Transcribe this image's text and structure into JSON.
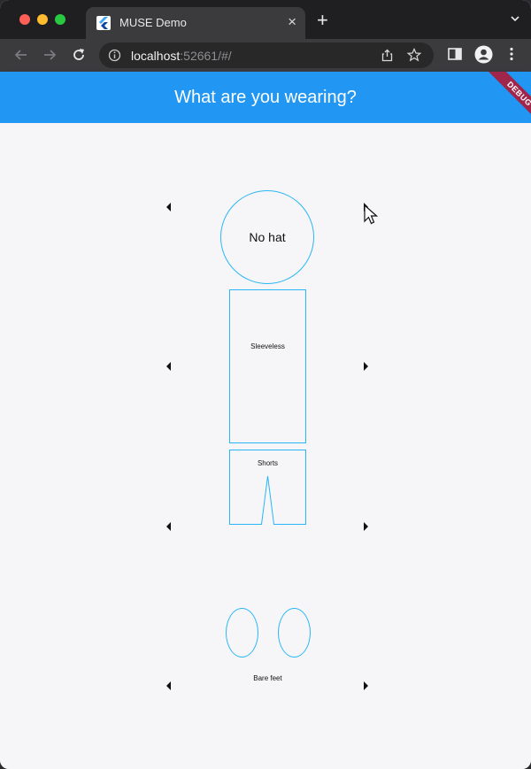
{
  "browser": {
    "tab_title": "MUSE Demo",
    "tab_close": "×",
    "new_tab": "+",
    "url_host": "localhost",
    "url_rest": ":52661/#/"
  },
  "app": {
    "title": "What are you wearing?",
    "debug_banner": "DEBUG",
    "accent_color": "#2196f3",
    "outline_color": "#29b6f6"
  },
  "outfit": {
    "hat": "No hat",
    "top": "Sleeveless",
    "bottom": "Shorts",
    "shoes": "Bare feet"
  }
}
